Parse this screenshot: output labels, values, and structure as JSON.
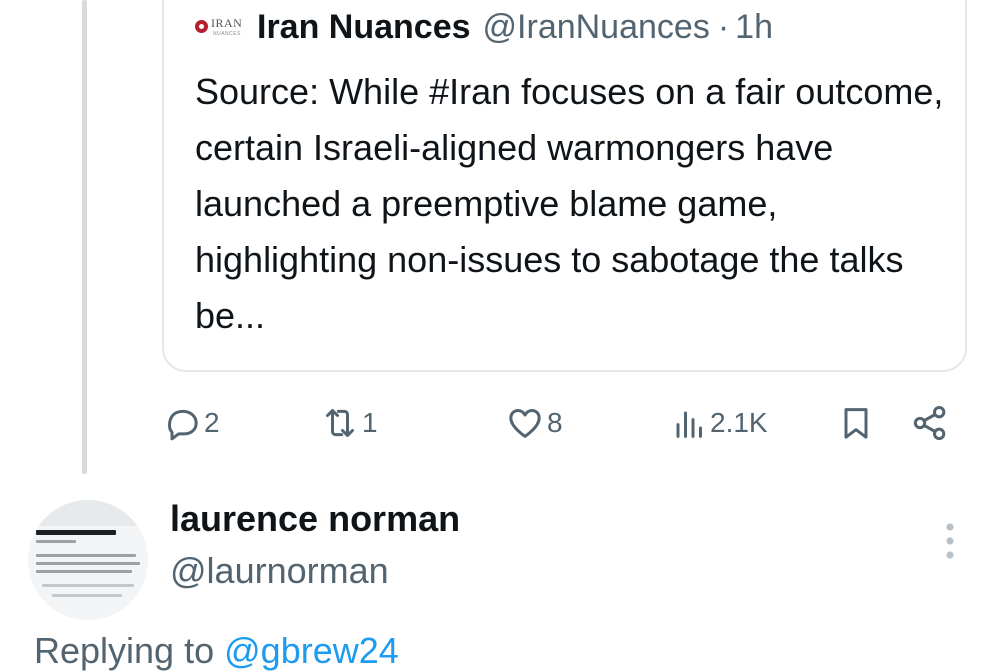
{
  "quoted_tweet": {
    "author_name": "Iran Nuances",
    "author_handle": "@IranNuances",
    "separator": "·",
    "time": "1h",
    "logo_text": "IRAN",
    "logo_subtext": "NUANCES",
    "text": "Source: While #Iran focuses on a fair outcome, certain Israeli-aligned warmongers have launched a preemptive blame game, highlighting non-issues to sabotage the talks be..."
  },
  "actions": {
    "replies": "2",
    "reposts": "1",
    "likes": "8",
    "views": "2.1K",
    "icons": [
      "reply-icon",
      "repost-icon",
      "like-icon",
      "views-icon",
      "bookmark-icon",
      "share-icon"
    ]
  },
  "reply": {
    "author_name": "laurence norman",
    "author_handle": "@laurnorman",
    "replying_prefix": "Replying to",
    "replying_to": "@gbrew24"
  },
  "colors": {
    "accent": "#1d9bf0",
    "secondary_text": "#536471",
    "primary_text": "#0f1419",
    "thread_line": "#d6dadd",
    "logo_red": "#b21f2d"
  }
}
